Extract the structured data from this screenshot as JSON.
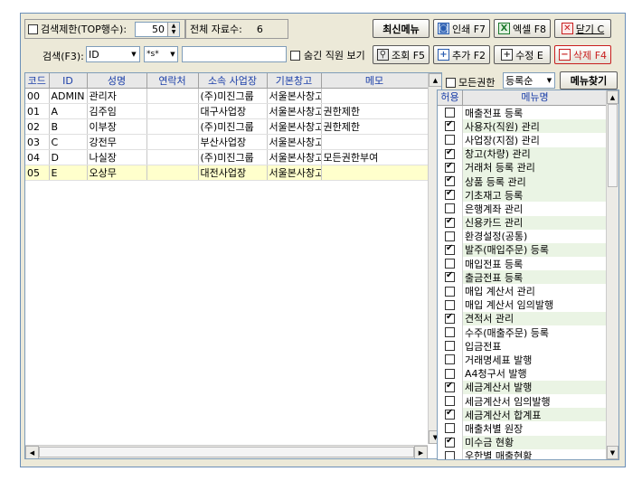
{
  "toolbar": {
    "limit_label": "검색제한(TOP행수):",
    "limit_value": "50",
    "total_label": "전체 자료수:",
    "total_value": "6",
    "search_label": "검색(F3):",
    "search_field": "ID",
    "search_op": "*s*",
    "search_value": "",
    "hidden_label": "숨긴 직원 보기",
    "latest_menu": "최신메뉴",
    "print": "인쇄 F7",
    "excel": "엑셀 F8",
    "close": "닫기 C",
    "query": "조회 F5",
    "add": "추가 F2",
    "edit": "수정 E",
    "delete": "삭제 F4"
  },
  "users_table": {
    "columns": [
      "코드",
      "ID",
      "성명",
      "연락처",
      "소속 사업장",
      "기본창고",
      "메모"
    ],
    "rows": [
      [
        "00",
        "ADMIN",
        "관리자",
        "",
        "(주)미진그룹",
        "서울본사창고",
        ""
      ],
      [
        "01",
        "A",
        "김주임",
        "",
        "대구사업장",
        "서울본사창고",
        "권한제한"
      ],
      [
        "02",
        "B",
        "이부장",
        "",
        "(주)미진그룹",
        "서울본사창고",
        "권한제한"
      ],
      [
        "03",
        "C",
        "강전무",
        "",
        "부산사업장",
        "서울본사창고",
        ""
      ],
      [
        "04",
        "D",
        "나실장",
        "",
        "(주)미진그룹",
        "서울본사창고",
        "모든권한부여"
      ],
      [
        "05",
        "E",
        "오상무",
        "",
        "대전사업장",
        "서울본사창고",
        ""
      ]
    ],
    "selected_index": 5
  },
  "menu_panel": {
    "all_perm_label": "모든권한",
    "sort_value": "등록순",
    "find_button": "메뉴찾기",
    "col_allow": "허용",
    "col_menu": "메뉴명",
    "items": [
      {
        "name": "매출전표 등록",
        "on": false
      },
      {
        "name": "사용자(직원) 관리",
        "on": true
      },
      {
        "name": "사업장(지점) 관리",
        "on": false
      },
      {
        "name": "창고(차량) 관리",
        "on": true
      },
      {
        "name": "거래처 등록 관리",
        "on": true
      },
      {
        "name": "상품 등록 관리",
        "on": true
      },
      {
        "name": "기초재고 등록",
        "on": true
      },
      {
        "name": "은행계좌 관리",
        "on": false
      },
      {
        "name": "신용카드 관리",
        "on": true
      },
      {
        "name": "환경설정(공통)",
        "on": false
      },
      {
        "name": "발주(매입주문) 등록",
        "on": true
      },
      {
        "name": "매입전표 등록",
        "on": false
      },
      {
        "name": "출금전표 등록",
        "on": true
      },
      {
        "name": "매입 계산서 관리",
        "on": false
      },
      {
        "name": "매입 계산서 임의발행",
        "on": false
      },
      {
        "name": "견적서 관리",
        "on": true
      },
      {
        "name": "수주(매출주문) 등록",
        "on": false
      },
      {
        "name": "입금전표",
        "on": false
      },
      {
        "name": "거래명세표 발행",
        "on": false
      },
      {
        "name": "A4청구서 발행",
        "on": false
      },
      {
        "name": "세금계산서 발행",
        "on": true
      },
      {
        "name": "세금계산서 임의발행",
        "on": false
      },
      {
        "name": "세금계산서 합계표",
        "on": true
      },
      {
        "name": "매출처별 원장",
        "on": false
      },
      {
        "name": "미수금 현황",
        "on": true
      },
      {
        "name": "우한별 매출현황",
        "on": false
      }
    ]
  }
}
